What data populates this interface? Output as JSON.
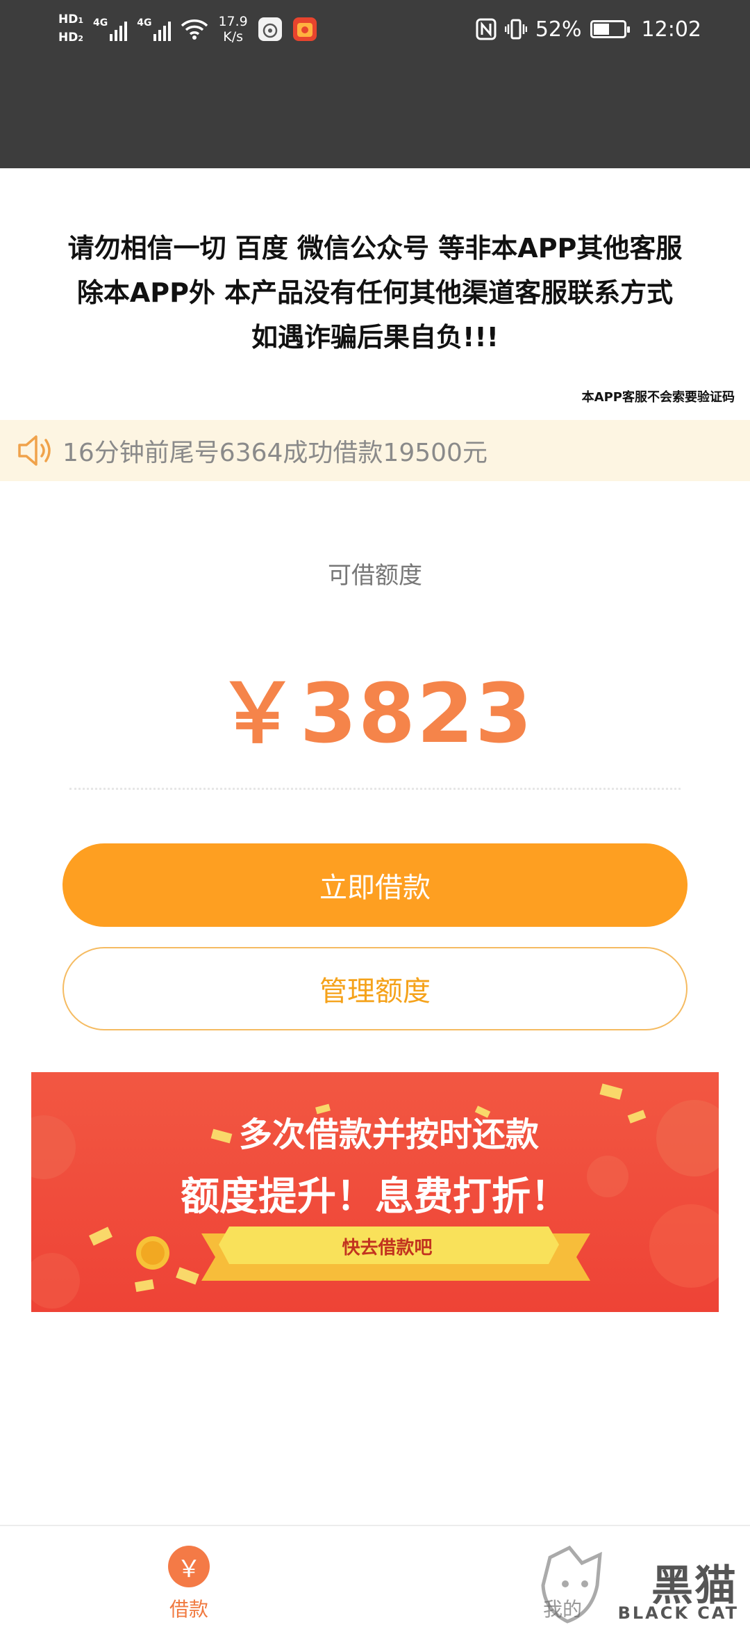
{
  "status_bar": {
    "hd1": "HD",
    "hd1_sub": "1",
    "hd2": "HD",
    "hd2_sub": "2",
    "net1": "4G",
    "net2": "4G",
    "speed_value": "17.9",
    "speed_unit": "K/s",
    "battery": "52%",
    "time": "12:02",
    "battery_level": 0.52
  },
  "notice": {
    "line1": "请勿相信一切 百度 微信公众号 等非本APP其他客服",
    "line2": "除本APP外 本产品没有任何其他渠道客服联系方式",
    "line3": "如遇诈骗后果自负!!!",
    "no_code": "本APP客服不会索要验证码"
  },
  "marquee": {
    "icon": "speaker-icon",
    "text": "16分钟前尾号6364成功借款19500元"
  },
  "credit": {
    "label": "可借额度",
    "amount": "￥3823"
  },
  "buttons": {
    "borrow": "立即借款",
    "manage": "管理额度"
  },
  "banner": {
    "line1": "多次借款并按时还款",
    "line2": "额度提升！息费打折！",
    "ribbon": "快去借款吧"
  },
  "bottom_nav": {
    "loan_icon": "￥",
    "loan_label": "借款",
    "me_label": "我的"
  },
  "watermark": {
    "cn": "黑猫",
    "en": "BLACK CAT"
  },
  "colors": {
    "primary_orange": "#fe9f21",
    "amount_orange": "#f5844a",
    "banner_red": "#ee4336",
    "status_bar": "#3d3d3d"
  }
}
